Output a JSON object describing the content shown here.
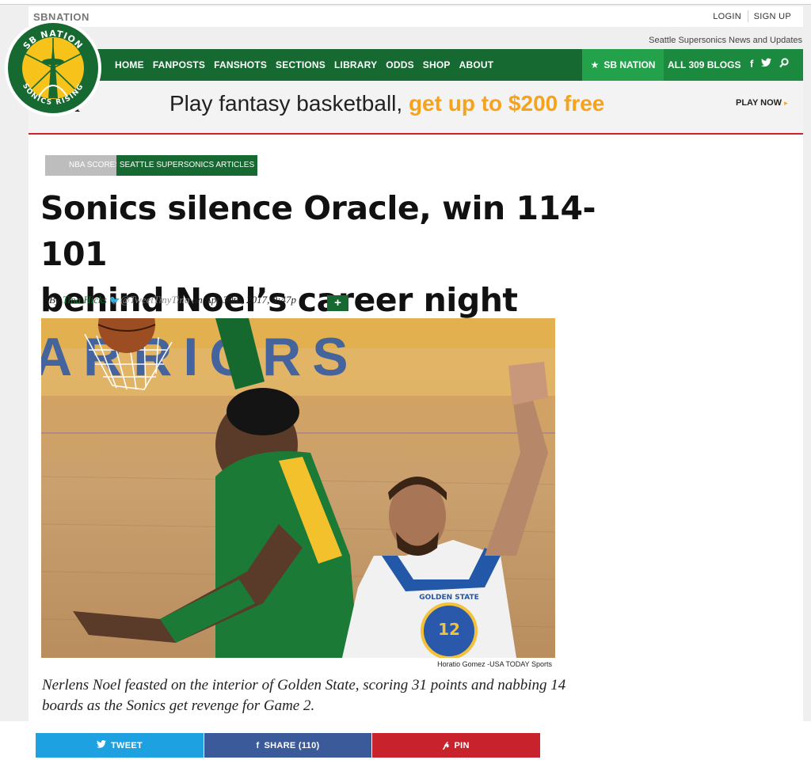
{
  "site": {
    "wordmark": "SBNATION",
    "tagline": "Seattle Supersonics News and Updates",
    "login": "LOGIN",
    "signup": "SIGN UP"
  },
  "logo": {
    "top_text": "SB NATION",
    "bottom_text": "SONICS RISING"
  },
  "nav": {
    "items": [
      "HOME",
      "FANPOSTS",
      "FANSHOTS",
      "SECTIONS",
      "LIBRARY",
      "ODDS",
      "SHOP",
      "ABOUT"
    ],
    "sbnation": "SB NATION",
    "all_blogs": "ALL 309 BLOGS",
    "social_icons": [
      "facebook-icon",
      "twitter-icon",
      "search-icon"
    ]
  },
  "ad": {
    "brand": "uel",
    "text_plain": "Play fantasy basketball, ",
    "text_highlight": "get up to $200 free",
    "cta": "PLAY NOW",
    "highlight_color": "#f6a21b"
  },
  "article": {
    "tags": [
      "NBA SCORES",
      "SEATTLE SUPERSONICS ARTICLES"
    ],
    "headline_line1": "Sonics silence Oracle, win 114-101",
    "headline_line2": "behind Noel’s career night",
    "byline": {
      "by": "By",
      "author": "Tina Hicks",
      "handle": "@TweetTinyTina",
      "date": "on Apr 30th, 2017, 9:47p"
    },
    "plus": "+",
    "photo_text": "ARRIORS",
    "jersey_team": "GOLDEN STATE",
    "jersey_number": "12",
    "photo_credit": "Horatio Gomez -USA TODAY Sports",
    "caption": "Nerlens Noel feasted on the interior of Golden State, scoring 31 points and nabbing 14 boards as the Sonics get revenge for Game 2."
  },
  "share": {
    "tweet": "TWEET",
    "facebook": "SHARE (110)",
    "pin": "PIN"
  },
  "colors": {
    "brand_green": "#166a31",
    "nav_accent": "#23a24b",
    "rule_red": "#c9252c",
    "twitter": "#1da1e0",
    "facebook": "#3b5a9a",
    "pinterest": "#c8232c"
  }
}
